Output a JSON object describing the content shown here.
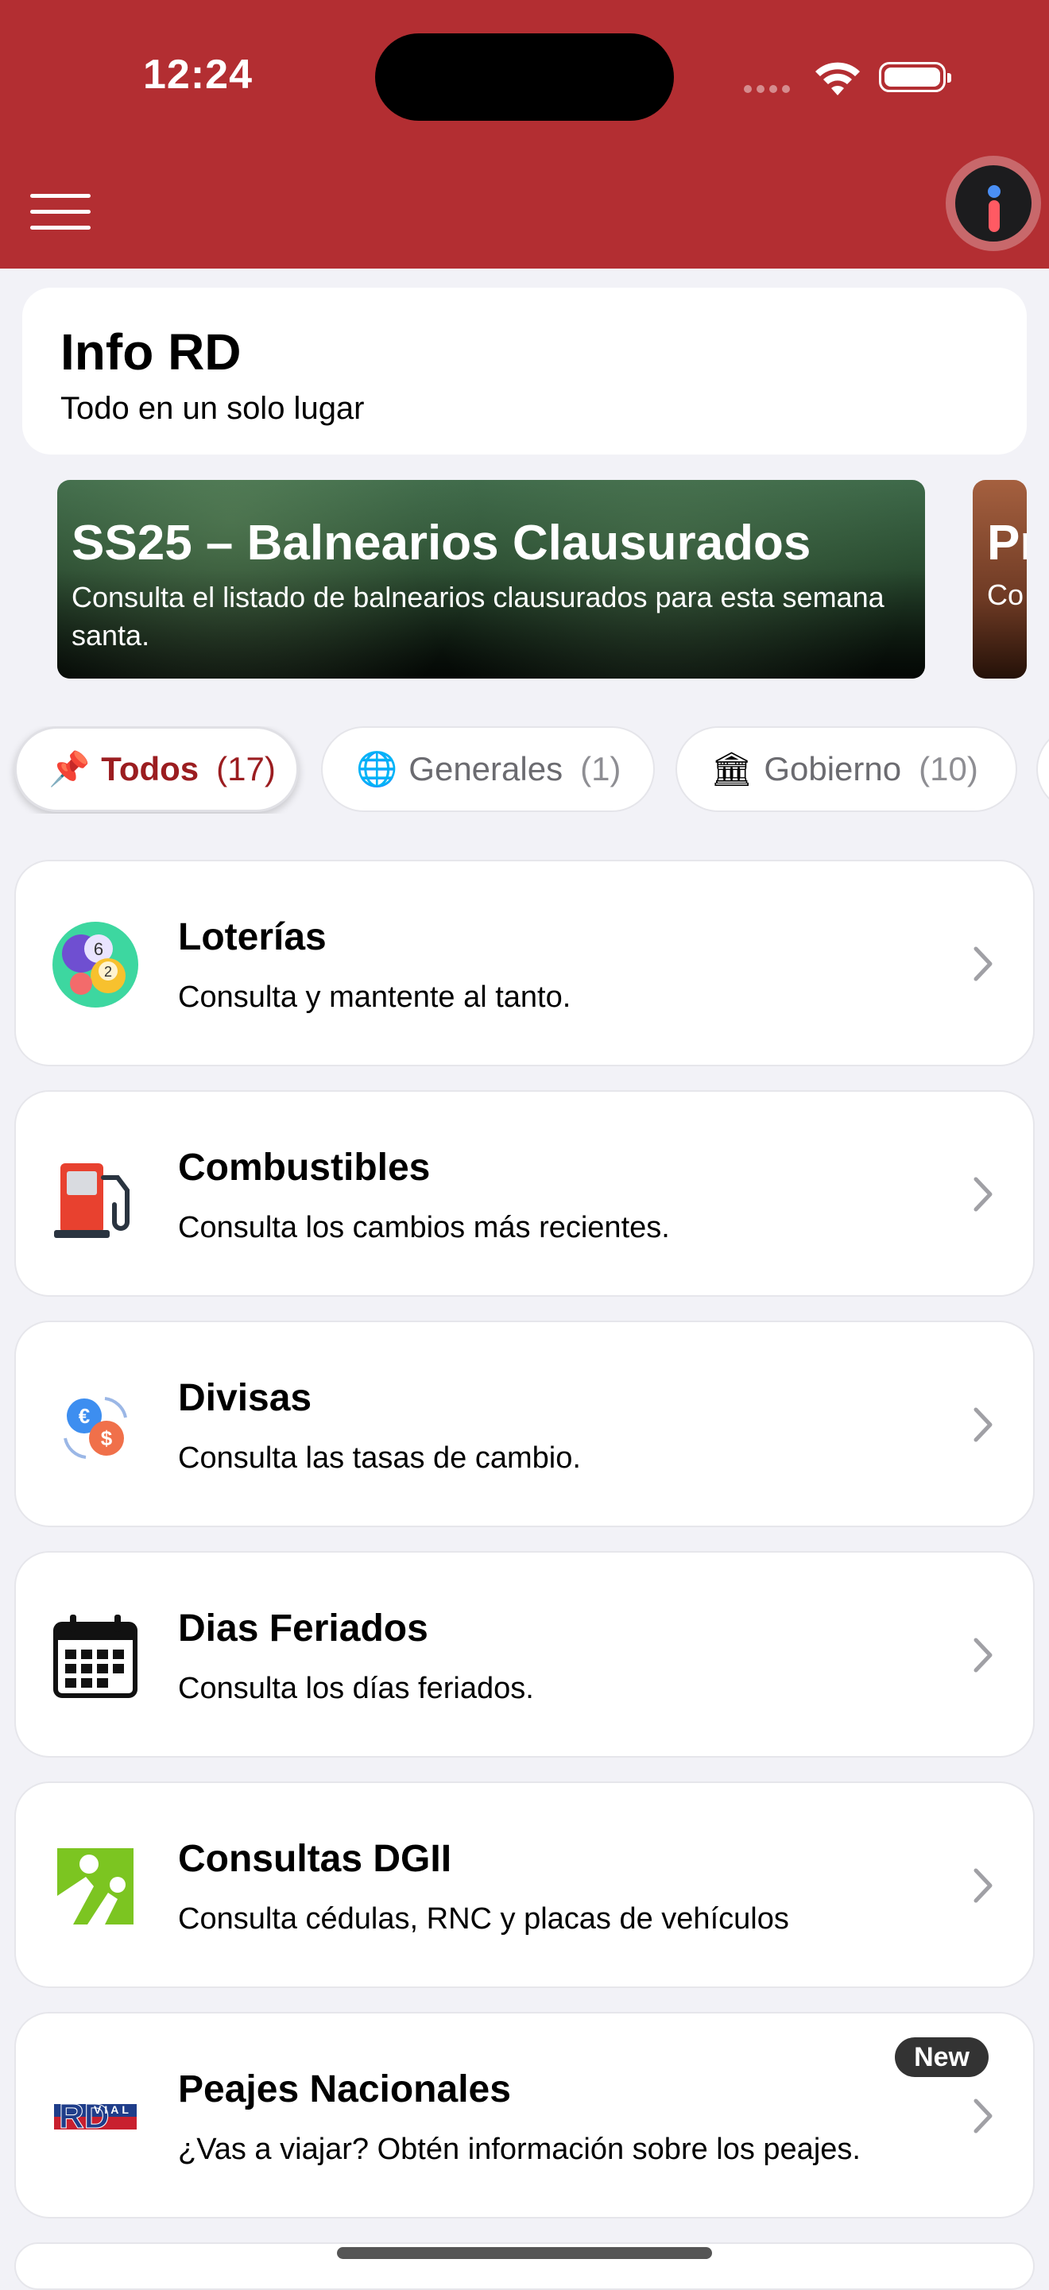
{
  "status_bar": {
    "time": "12:24"
  },
  "header": {
    "background_color": "#b32e32",
    "menu_icon": "hamburger-icon",
    "info_icon": "info-icon"
  },
  "title_card": {
    "title": "Info RD",
    "subtitle": "Todo en un solo lugar"
  },
  "banners": [
    {
      "title": "SS25 – Balnearios Clausurados",
      "description": "Consulta el listado de balnearios clausurados para esta semana santa."
    },
    {
      "title": "Pr",
      "description": "Co"
    }
  ],
  "chips": [
    {
      "icon": "pushpin-icon",
      "label": "Todos",
      "count": "(17)"
    },
    {
      "icon": "globe-icon",
      "label": "Generales",
      "count": "(1)"
    },
    {
      "icon": "government-building-icon",
      "label": "Gobierno",
      "count": "(10)"
    }
  ],
  "items": [
    {
      "icon": "lottery-balls-icon",
      "title": "Loterías",
      "subtitle": "Consulta y mantente al tanto."
    },
    {
      "icon": "fuel-pump-icon",
      "title": "Combustibles",
      "subtitle": "Consulta los cambios más recientes."
    },
    {
      "icon": "currency-exchange-icon",
      "title": "Divisas",
      "subtitle": "Consulta las tasas de cambio."
    },
    {
      "icon": "calendar-icon",
      "title": "Dias Feriados",
      "subtitle": "Consulta los días feriados."
    },
    {
      "icon": "dgii-logo-icon",
      "title": "Consultas DGII",
      "subtitle": "Consulta cédulas, RNC y placas de vehículos"
    },
    {
      "icon": "rd-vial-logo-icon",
      "title": "Peajes Nacionales",
      "subtitle": "¿Vas a viajar? Obtén información sobre los peajes.",
      "badge": "New"
    }
  ],
  "colors": {
    "accent": "#9b1d20",
    "background": "#f2f2f7"
  }
}
